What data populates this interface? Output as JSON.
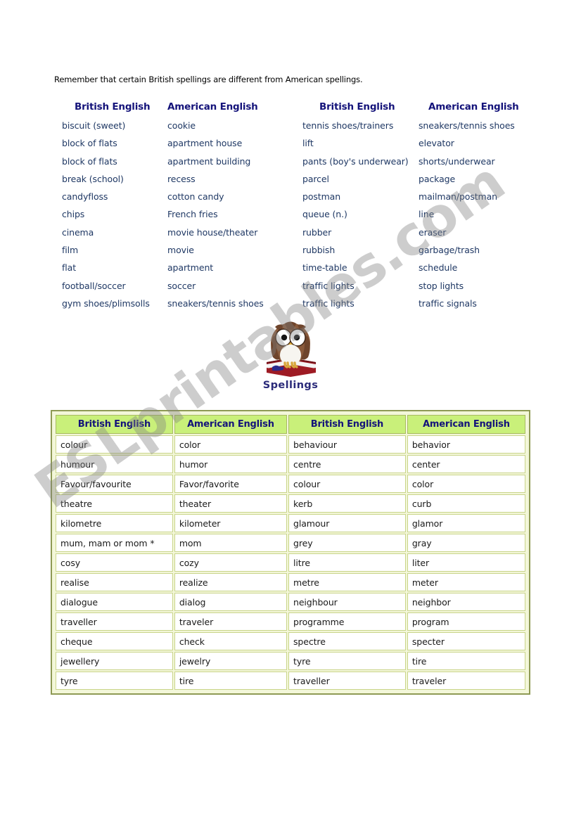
{
  "intro": {
    "text": "Remember that certain British spellings are different from American spellings."
  },
  "vocab_columns": {
    "headers": [
      "British English",
      "American English",
      "British English",
      "American English"
    ],
    "col_british_1": [
      "biscuit (sweet)",
      "block of flats",
      "block of flats",
      "break (school)",
      "candyfloss",
      "chips",
      "cinema",
      "film",
      "flat",
      "football/soccer",
      "gym shoes/plimsolls"
    ],
    "col_american_1": [
      "cookie",
      "apartment house",
      "apartment building",
      "recess",
      "cotton candy",
      "French fries",
      "movie house/theater",
      "movie",
      "apartment",
      "soccer",
      "sneakers/tennis shoes"
    ],
    "col_british_2": [
      "tennis shoes/trainers",
      "lift",
      "pants (boy's underwear)",
      "parcel",
      "postman",
      "queue (n.)",
      "rubber",
      "rubbish",
      "time-table",
      "traffic lights",
      "traffic lights"
    ],
    "col_american_2": [
      "sneakers/tennis shoes",
      "elevator",
      "shorts/underwear",
      "package",
      "mailman/postman",
      "line",
      "eraser",
      "garbage/trash",
      "schedule",
      "stop lights",
      "traffic signals"
    ]
  },
  "graphic": {
    "icon_name": "owl-on-book-icon",
    "caption": "Spellings"
  },
  "spelling_table": {
    "headers": [
      "British English",
      "American English",
      "British English",
      "American English"
    ],
    "rows": [
      [
        "colour",
        "color",
        "behaviour",
        "behavior"
      ],
      [
        "humour",
        "humor",
        "centre",
        "center"
      ],
      [
        "Favour/favourite",
        "Favor/favorite",
        "colour",
        "color"
      ],
      [
        "theatre",
        "theater",
        "kerb",
        "curb"
      ],
      [
        "kilometre",
        "kilometer",
        "glamour",
        "glamor"
      ],
      [
        "mum, mam or mom *",
        "mom",
        "grey",
        "gray"
      ],
      [
        "cosy",
        "cozy",
        "litre",
        "liter"
      ],
      [
        "realise",
        "realize",
        "metre",
        "meter"
      ],
      [
        "dialogue",
        "dialog",
        "neighbour",
        "neighbor"
      ],
      [
        "traveller",
        "traveler",
        "programme",
        "program"
      ],
      [
        "cheque",
        "check",
        "spectre",
        "specter"
      ],
      [
        "jewellery",
        "jewelry",
        "tyre",
        "tire"
      ],
      [
        "tyre",
        "tire",
        "traveller",
        "traveler"
      ]
    ]
  },
  "watermark": {
    "text": "ESLprintables.com"
  },
  "colors": {
    "heading_navy": "#14137a",
    "word_text_blue": "#1f3864",
    "table_header_green": "#c9f07a",
    "table_border_olive": "#8e9a54",
    "cell_border": "#c9d48a",
    "watermark_gray": "#828282"
  }
}
